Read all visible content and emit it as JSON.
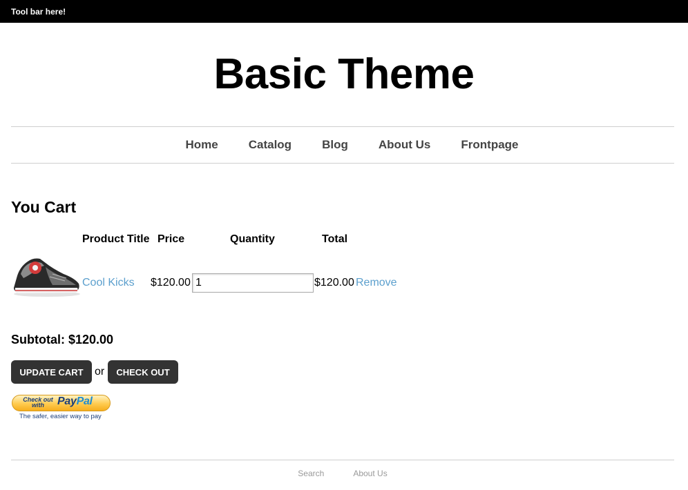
{
  "toolbar": {
    "text": "Tool bar here!"
  },
  "site": {
    "title": "Basic Theme"
  },
  "nav": [
    "Home",
    "Catalog",
    "Blog",
    "About Us",
    "Frontpage"
  ],
  "cart": {
    "heading": "You Cart",
    "columns": {
      "product_title": "Product Title",
      "price": "Price",
      "quantity": "Quantity",
      "total": "Total"
    },
    "items": [
      {
        "title": "Cool Kicks",
        "price": "$120.00",
        "quantity": "1",
        "total": "$120.00",
        "remove": "Remove"
      }
    ],
    "subtotal": "Subtotal: $120.00",
    "update_label": "Update Cart",
    "or_text": "or",
    "checkout_label": "Check Out"
  },
  "paypal": {
    "check_out_with": "Check out with",
    "logo_pay": "Pay",
    "logo_pal": "Pal",
    "tagline": "The safer, easier way to pay"
  },
  "footer": [
    "Search",
    "About Us"
  ],
  "colors": {
    "link": "#5b9fcd",
    "button": "#333333",
    "toolbar": "#000000"
  }
}
